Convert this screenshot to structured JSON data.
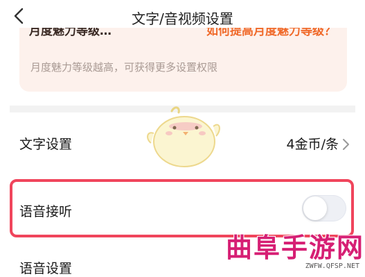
{
  "header": {
    "title": "文字/音视频设置"
  },
  "promo": {
    "top_left_partial": "月度魅力等级…",
    "top_right_partial": "如何提高月度魅力等级？",
    "description": "月度魅力等级越高，可获得更多设置权限"
  },
  "settings": {
    "text_settings": {
      "label": "文字设置",
      "price": "4金币/条"
    },
    "voice_answer": {
      "label": "语音接听",
      "enabled": false
    },
    "voice_settings": {
      "label": "语音设置"
    }
  },
  "watermark": {
    "title": "曲阜手游网",
    "domain": "ZWFW.QFSP.NET"
  },
  "colors": {
    "highlight_border": "#f0455c",
    "promo_bg": "#fdf1ec",
    "promo_link": "#f06a2a",
    "watermark": "#d61f74"
  }
}
